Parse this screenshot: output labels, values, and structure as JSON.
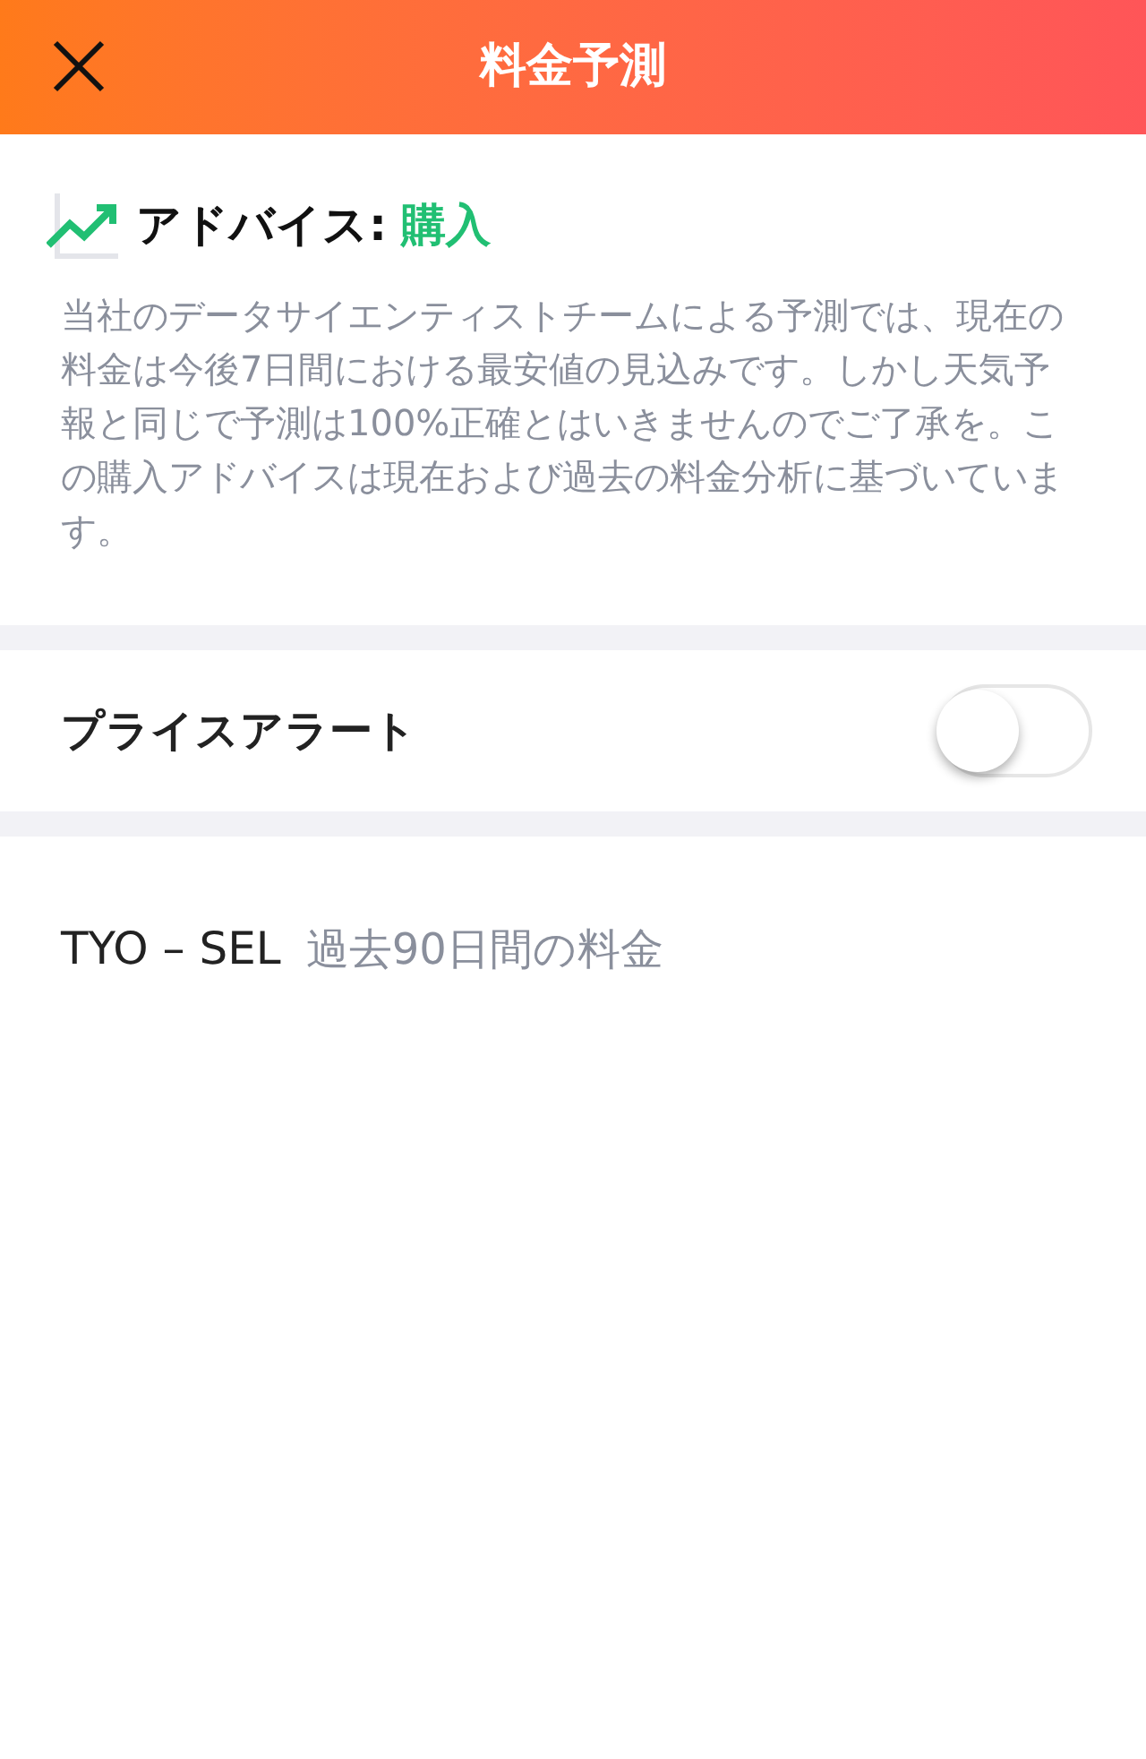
{
  "header": {
    "title": "料金予測"
  },
  "advice": {
    "label": "アドバイス:",
    "value": "購入",
    "description": "当社のデータサイエンティストチームによる予測では、現在の料金は今後7日間における最安値の見込みです。しかし天気予報と同じで予測は100%正確とはいきませんのでご了承を。この購入アドバイスは現在および過去の料金分析に基づいています。"
  },
  "price_alert": {
    "label": "プライスアラート",
    "on": false
  },
  "history": {
    "route": "TYO – SEL",
    "caption": "過去90日間の料金"
  }
}
